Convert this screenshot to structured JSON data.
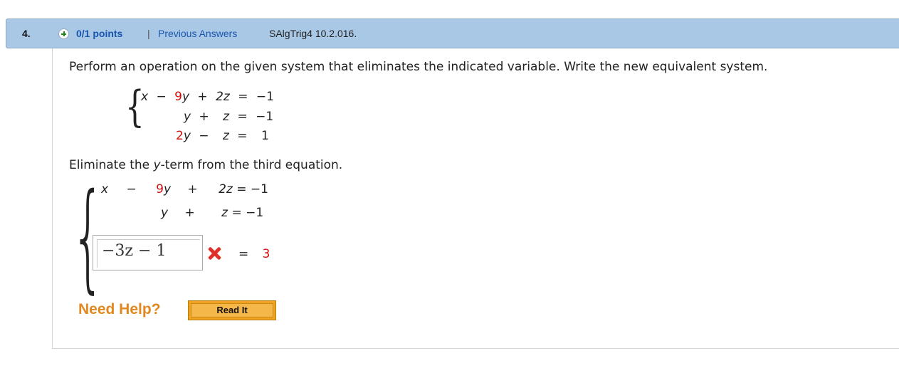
{
  "header": {
    "number": "4.",
    "points": "0/1 points",
    "separator": "|",
    "previous_answers": "Previous Answers",
    "code": "SAlgTrig4 10.2.016."
  },
  "prompt": "Perform an operation on the given system that eliminates the indicated variable. Write the new equivalent system.",
  "system": {
    "eq1": {
      "a": "x",
      "op1": "−",
      "b_coef": "9",
      "b_var": "y",
      "op2": "+",
      "c": "2z",
      "eq": "=",
      "rhs": "−1"
    },
    "eq2": {
      "b_var": "y",
      "op2": "+",
      "c": "z",
      "eq": "=",
      "rhs": "−1"
    },
    "eq3": {
      "b_coef": "2",
      "b_var": "y",
      "op2": "−",
      "c": "z",
      "eq": "=",
      "rhs": "1"
    }
  },
  "instruction": {
    "pre": "Eliminate the ",
    "var": "y",
    "post": "-term from the third equation."
  },
  "new_system": {
    "eq1": {
      "a": "x",
      "op1": "−",
      "b_coef": "9",
      "b_var": "y",
      "op2": "+",
      "c": "2z",
      "eq": "=",
      "rhs": "−1"
    },
    "eq2": {
      "b_var": "y",
      "op2": "+",
      "c": "z",
      "eq": "=",
      "rhs": "−1"
    },
    "eq3": {
      "answer": "−3z − 1",
      "eq": "=",
      "rhs": "3",
      "status_icon": "incorrect-x-icon"
    }
  },
  "help": {
    "label": "Need Help?",
    "read_it": "Read It"
  },
  "colors": {
    "header_bg": "#a9c8e6",
    "link": "#1a55b0",
    "red": "#d01010",
    "help_orange": "#e2881f"
  }
}
